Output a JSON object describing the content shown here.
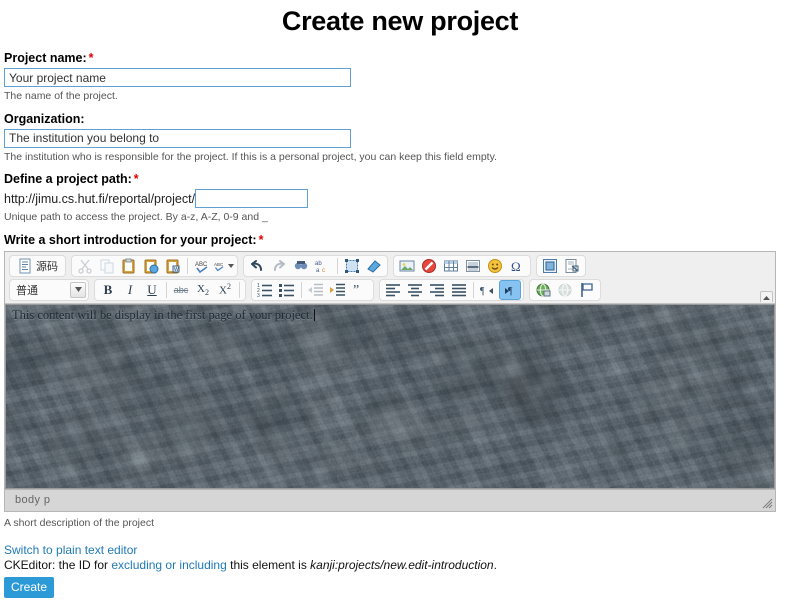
{
  "page": {
    "title": "Create new project",
    "required_mark": "*"
  },
  "fields": {
    "project_name": {
      "label": "Project name:",
      "value": "Your project name",
      "description": "The name of the project."
    },
    "organization": {
      "label": "Organization:",
      "value": "The institution you belong to",
      "description": "The institution who is responsible for the project. If this is a personal project, you can keep this field empty."
    },
    "project_path": {
      "label": "Define a project path:",
      "prefix": "http://jimu.cs.hut.fi/reportal/project/",
      "value": "",
      "description": "Unique path to access the project. By a-z, A-Z, 0-9 and _"
    },
    "introduction": {
      "label": "Write a short introduction for your project:",
      "description": "A short description of the project"
    }
  },
  "editor": {
    "toolbar_row1": [
      {
        "name": "source-icon",
        "label": "源码",
        "state": "normal",
        "group": 1
      },
      {
        "name": "cut-icon",
        "label": "",
        "state": "disabled",
        "group": 2
      },
      {
        "name": "copy-icon",
        "label": "",
        "state": "disabled",
        "group": 2
      },
      {
        "name": "paste-icon",
        "label": "",
        "state": "normal",
        "group": 2
      },
      {
        "name": "paste-text-icon",
        "label": "",
        "state": "normal",
        "group": 2
      },
      {
        "name": "paste-word-icon",
        "label": "",
        "state": "normal",
        "group": 2
      },
      {
        "name": "spellcheck-icon",
        "label": "",
        "state": "normal",
        "group": 2
      },
      {
        "name": "spellcheck-options-icon",
        "label": "",
        "state": "normal",
        "group": 2
      },
      {
        "name": "undo-icon",
        "label": "",
        "state": "normal",
        "group": 3
      },
      {
        "name": "redo-icon",
        "label": "",
        "state": "disabled",
        "group": 3
      },
      {
        "name": "find-icon",
        "label": "",
        "state": "normal",
        "group": 3
      },
      {
        "name": "replace-icon",
        "label": "",
        "state": "normal",
        "group": 3
      },
      {
        "name": "select-all-icon",
        "label": "",
        "state": "normal",
        "group": 3
      },
      {
        "name": "remove-format-icon",
        "label": "",
        "state": "normal",
        "group": 3
      },
      {
        "name": "image-icon",
        "label": "",
        "state": "normal",
        "group": 4
      },
      {
        "name": "flash-icon",
        "label": "",
        "state": "normal",
        "group": 4
      },
      {
        "name": "table-icon",
        "label": "",
        "state": "normal",
        "group": 4
      },
      {
        "name": "horizontal-rule-icon",
        "label": "",
        "state": "normal",
        "group": 4
      },
      {
        "name": "smiley-icon",
        "label": "",
        "state": "normal",
        "group": 4
      },
      {
        "name": "special-char-icon",
        "label": "",
        "state": "normal",
        "group": 4
      },
      {
        "name": "iframe-icon",
        "label": "",
        "state": "normal",
        "group": 5
      },
      {
        "name": "page-break-icon",
        "label": "",
        "state": "normal",
        "group": 5
      }
    ],
    "format_combo": {
      "name": "paragraph-format-select",
      "value": "普通"
    },
    "toolbar_row2": [
      {
        "name": "bold-icon",
        "label": "B",
        "state": "normal",
        "group": 1
      },
      {
        "name": "italic-icon",
        "label": "I",
        "state": "normal",
        "group": 1
      },
      {
        "name": "underline-icon",
        "label": "U",
        "state": "normal",
        "group": 1
      },
      {
        "name": "strikethrough-icon",
        "label": "abc",
        "state": "normal",
        "group": 1
      },
      {
        "name": "subscript-icon",
        "label": "X2",
        "state": "normal",
        "group": 1
      },
      {
        "name": "superscript-icon",
        "label": "X2",
        "state": "normal",
        "group": 1
      },
      {
        "name": "numbered-list-icon",
        "label": "",
        "state": "normal",
        "group": 2
      },
      {
        "name": "bulleted-list-icon",
        "label": "",
        "state": "normal",
        "group": 2
      },
      {
        "name": "outdent-icon",
        "label": "",
        "state": "disabled",
        "group": 2
      },
      {
        "name": "indent-icon",
        "label": "",
        "state": "normal",
        "group": 2
      },
      {
        "name": "blockquote-icon",
        "label": "",
        "state": "normal",
        "group": 2
      },
      {
        "name": "align-left-icon",
        "label": "",
        "state": "normal",
        "group": 3
      },
      {
        "name": "align-center-icon",
        "label": "",
        "state": "normal",
        "group": 3
      },
      {
        "name": "align-right-icon",
        "label": "",
        "state": "normal",
        "group": 3
      },
      {
        "name": "align-justify-icon",
        "label": "",
        "state": "normal",
        "group": 3
      },
      {
        "name": "text-direction-rtl-icon",
        "label": "",
        "state": "normal",
        "group": 3
      },
      {
        "name": "text-direction-ltr-icon",
        "label": "",
        "state": "active",
        "group": 3
      },
      {
        "name": "link-icon",
        "label": "",
        "state": "normal",
        "group": 4
      },
      {
        "name": "unlink-icon",
        "label": "",
        "state": "disabled",
        "group": 4
      },
      {
        "name": "anchor-icon",
        "label": "",
        "state": "normal",
        "group": 4
      }
    ],
    "content_text": "This content will be display in the first page of your project.",
    "elements_path": "body  p",
    "collapse_toolbar_title": "collapse-toolbar"
  },
  "footer": {
    "switch_link": "Switch to plain text editor",
    "note_prefix": "CKEditor: the ID for ",
    "note_link": "excluding or including",
    "note_middle": " this element is ",
    "note_id": "kanji:projects/new.edit-introduction",
    "note_suffix": ".",
    "create_label": "Create"
  },
  "colors": {
    "accent": "#2d9ad8",
    "link": "#1f7ab5",
    "required": "#e00000",
    "input_border": "#62a0d4"
  }
}
